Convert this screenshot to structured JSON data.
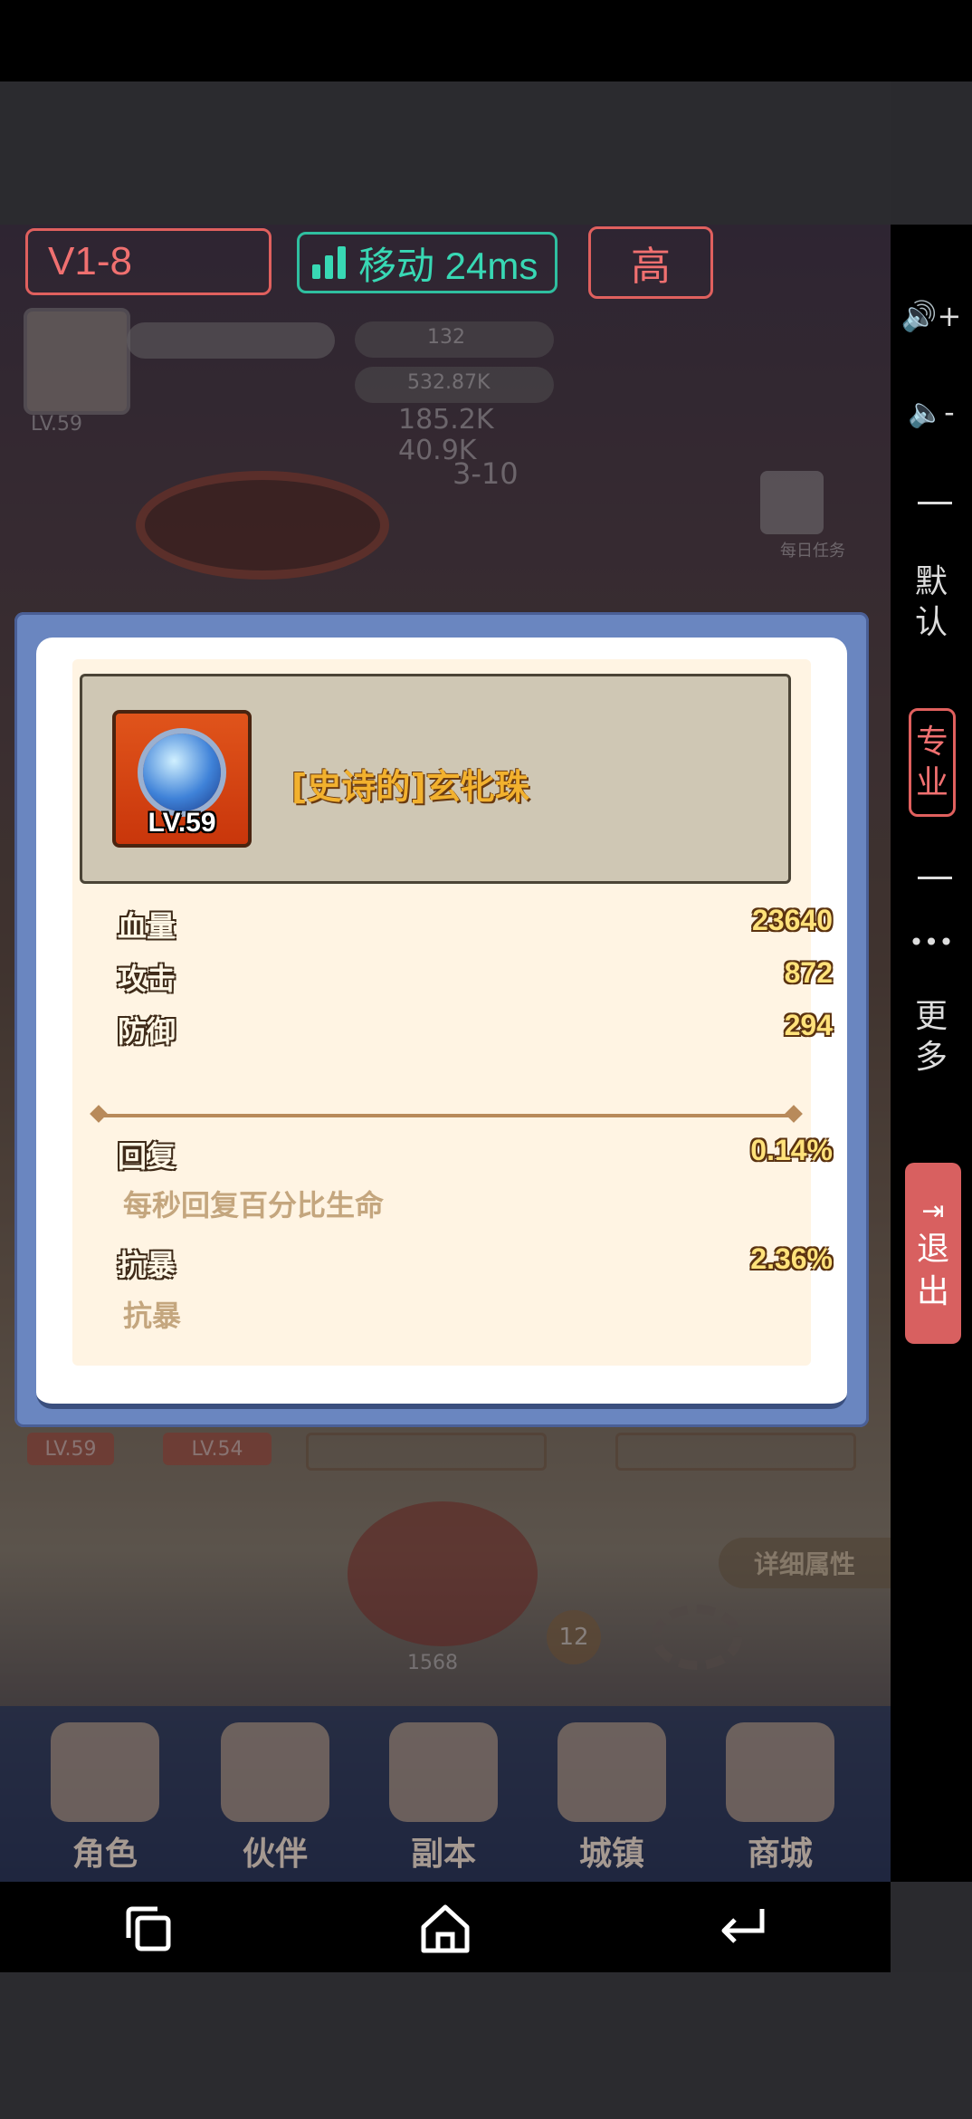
{
  "status_bar": {
    "version": "V1-8",
    "network": "移动 24ms",
    "quality": "高"
  },
  "side_panel": {
    "volume_up": "🔊+",
    "volume_down": "🔈-",
    "default": [
      "默",
      "认"
    ],
    "pro": [
      "专",
      "业"
    ],
    "more_dots": "•••",
    "more": [
      "更",
      "多"
    ],
    "exit": [
      "退",
      "出"
    ]
  },
  "game_bg": {
    "player_level": "LV.59",
    "gems": "132",
    "gold": "532.87K",
    "power1": "185.2K",
    "power2": "40.9K",
    "stage": "3-10",
    "daily_task": "每日任务",
    "lv_tags": [
      "LV.59",
      "LV.54"
    ],
    "detail_button": "详细属性",
    "stack_count": "12",
    "bottom_value": "1568"
  },
  "tabs": [
    "角色",
    "伙伴",
    "副本",
    "城镇",
    "商城"
  ],
  "item": {
    "level": "LV.59",
    "name": "[史诗的]玄牝珠",
    "base_stats": [
      {
        "label": "血量",
        "value": "23640"
      },
      {
        "label": "攻击",
        "value": "872"
      },
      {
        "label": "防御",
        "value": "294"
      }
    ],
    "special_stats": [
      {
        "label": "回复",
        "value": "0.14%",
        "desc": "每秒回复百分比生命"
      },
      {
        "label": "抗暴",
        "value": "2.36%",
        "desc": "抗暴"
      }
    ]
  },
  "colors": {
    "accent_red": "#e0605e",
    "accent_teal": "#2fbfa0",
    "item_gold": "#f2b12e",
    "modal_blue": "#6a86c0"
  }
}
